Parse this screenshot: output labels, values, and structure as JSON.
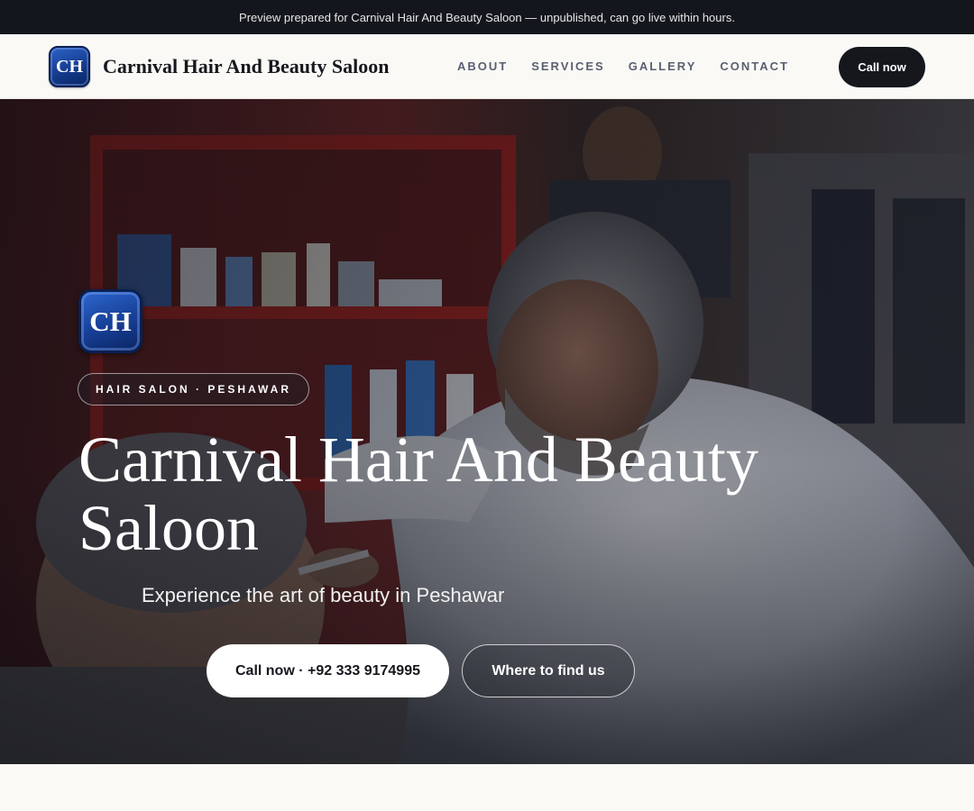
{
  "banner": {
    "text": "Preview prepared for Carnival Hair And Beauty Saloon — unpublished, can go live within hours."
  },
  "header": {
    "logo_initials": "CH",
    "brand_name": "Carnival Hair And Beauty Saloon",
    "nav": [
      {
        "label": "ABOUT"
      },
      {
        "label": "SERVICES"
      },
      {
        "label": "GALLERY"
      },
      {
        "label": "CONTACT"
      }
    ],
    "cta_label": "Call now"
  },
  "hero": {
    "logo_initials": "CH",
    "eyebrow": "HAIR SALON · PESHAWAR",
    "title": "Carnival Hair And Beauty Saloon",
    "tagline": "Experience the art of beauty in Peshawar",
    "primary_button": "Call now · +92 333 9174995",
    "secondary_button": "Where to find us"
  },
  "colors": {
    "banner_bg": "#13161c",
    "header_bg": "#faf9f6",
    "cta_bg": "#15171d",
    "logo_blue": "#1a46a0",
    "nav_text": "#596070"
  }
}
